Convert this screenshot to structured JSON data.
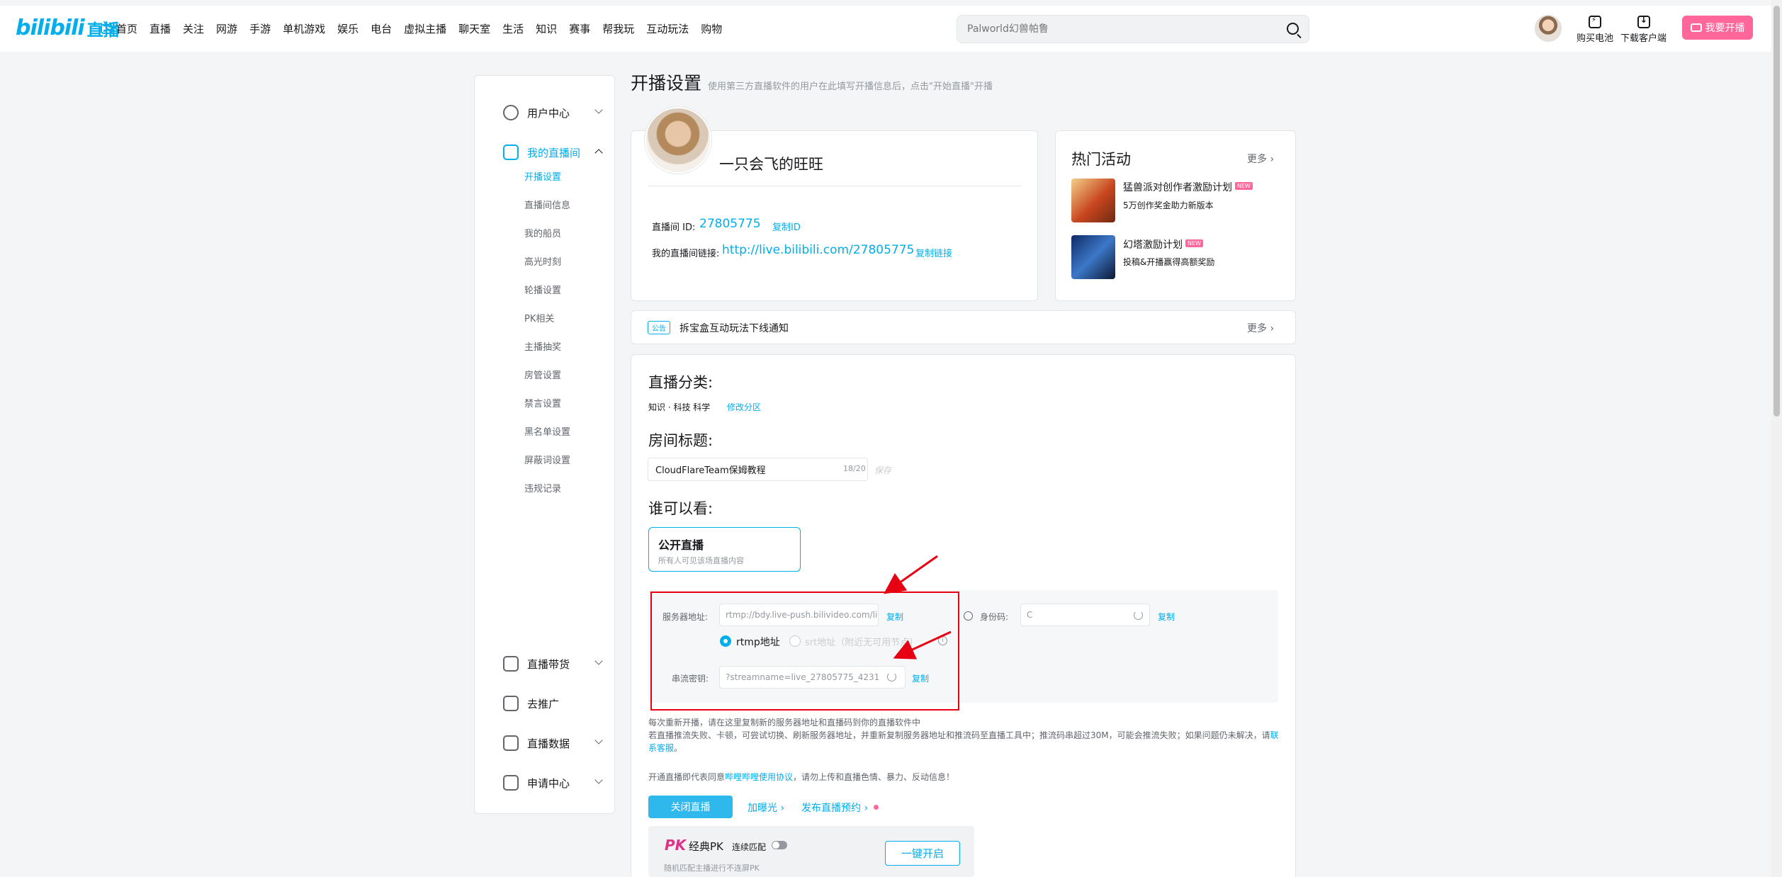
{
  "header": {
    "logo_text": "bilibili",
    "logo_suffix": "直播",
    "nav": [
      "首页",
      "直播",
      "关注",
      "网游",
      "手游",
      "单机游戏",
      "娱乐",
      "电台",
      "虚拟主播",
      "聊天室",
      "生活",
      "知识",
      "赛事",
      "帮我玩",
      "互动玩法",
      "购物"
    ],
    "search_placeholder": "Palworld幻兽帕鲁",
    "buy_battery": "购买电池",
    "download_client": "下载客户端",
    "go_live": "我要开播"
  },
  "sidebar": {
    "user_center": "用户中心",
    "my_room": "我的直播间",
    "sub_items": [
      "开播设置",
      "直播间信息",
      "我的船员",
      "高光时刻",
      "轮播设置",
      "PK相关",
      "主播抽奖",
      "房管设置",
      "禁言设置",
      "黑名单设置",
      "屏蔽词设置",
      "违规记录"
    ],
    "commerce": "直播带货",
    "promote": "去推广",
    "stats": "直播数据",
    "apply": "申请中心"
  },
  "page": {
    "title": "开播设置",
    "desc": "使用第三方直播软件的用户在此填写开播信息后，点击\"开始直播\"开播"
  },
  "room": {
    "anchor_name": "一只会飞的旺旺",
    "id_label": "直播间 ID:",
    "id_value": "27805775",
    "copy_id": "复制ID",
    "link_label": "我的直播间链接:",
    "link_value": "http://live.bilibili.com/27805775",
    "copy_link": "复制链接"
  },
  "hot": {
    "title": "热门活动",
    "more": "更多",
    "items": [
      {
        "title": "猛兽派对创作者激励计划",
        "sub": "5万创作奖金助力新版本",
        "badge": "NEW"
      },
      {
        "title": "幻塔激励计划",
        "sub": "投稿&开播赢得高额奖励",
        "badge": "NEW"
      }
    ]
  },
  "notice": {
    "badge": "公告",
    "text": "拆宝盒互动玩法下线通知",
    "more": "更多"
  },
  "settings": {
    "category_title": "直播分类:",
    "category_value": "知识 · 科技 科学",
    "change_category": "修改分区",
    "room_title_label": "房间标题:",
    "room_title_value": "CloudFlareTeam保姆教程",
    "counter": "18/20",
    "save": "保存",
    "visibility_title": "谁可以看:",
    "visibility_option": "公开直播",
    "visibility_desc": "所有人可见该场直播内容"
  },
  "stream": {
    "server_label": "服务器地址:",
    "server_value": "rtmp://bdy.live-push.bilivideo.com/live-bvc/",
    "copy": "复制",
    "identity_label": "身份码:",
    "identity_value": "C",
    "rtmp": "rtmp地址",
    "srt": "srt地址（附近无可用节点）",
    "key_label": "串流密钥:",
    "key_value": "?streamname=live_27805775_4231",
    "copy_key": "复制"
  },
  "help": {
    "line1": "每次重新开播，请在这里复制新的服务器地址和直播码到你的直播软件中",
    "line2": "若直播推流失败、卡顿，可尝试切换、刷新服务器地址，并重新复制服务器地址和推流码至直播工具中；推流码串超过30M，可能会推流失败；如果问题仍未解决，请",
    "line2_link": "联系客服",
    "line2_end": "。",
    "line3_pre": "开通直播即代表同意",
    "line3_link": "哔哩哔哩使用协议",
    "line3_post": "，请勿上传和直播色情、暴力、反动信息！"
  },
  "actions": {
    "close_live": "关闭直播",
    "boost": "加曝光",
    "publish_schedule": "发布直播预约"
  },
  "pk": {
    "icon": "PK",
    "title": "经典PK",
    "toggle_label": "连续匹配",
    "sub": "随机匹配主播进行不连屏PK",
    "button": "一键开启"
  },
  "colors": {
    "accent": "#00aeec",
    "pink": "#ff6699",
    "highlight": "#e60012"
  }
}
